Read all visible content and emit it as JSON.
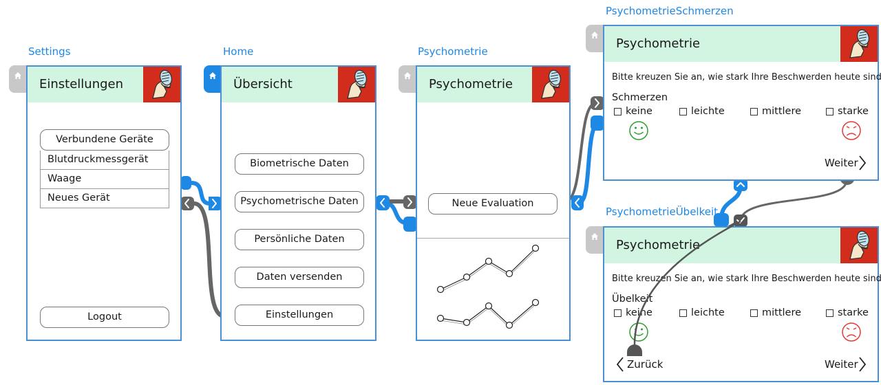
{
  "colors": {
    "accent": "#1e88e5",
    "header_bg": "#d2f5e2",
    "logo_red": "#d22c1c",
    "connector_gray": "#666666",
    "smiley_green": "#2ca02c",
    "frown_red": "#e53935"
  },
  "settings": {
    "label": "Settings",
    "title": "Einstellungen",
    "connected_devices_button": "Verbundene Geräte",
    "devices": [
      "Blutdruckmessgerät",
      "Waage",
      "Neues Gerät"
    ],
    "logout_button": "Logout"
  },
  "home": {
    "label": "Home",
    "title": "Übersicht",
    "buttons": [
      "Biometrische Daten",
      "Psychometrische Daten",
      "Persönliche Daten",
      "Daten versenden",
      "Einstellungen"
    ]
  },
  "psychometrie": {
    "label": "Psychometrie",
    "title": "Psychometrie",
    "new_eval_button": "Neue Evaluation"
  },
  "schmerzen": {
    "label": "PsychometrieSchmerzen",
    "title": "Psychometrie",
    "instruction": "Bitte kreuzen Sie an, wie stark Ihre Beschwerden heute sind.",
    "question": "Schmerzen",
    "options": [
      "keine",
      "leichte",
      "mittlere",
      "starke"
    ],
    "next": "Weiter"
  },
  "uebelkeit": {
    "label": "PsychometrieÜbelkeit",
    "title": "Psychometrie",
    "instruction": "Bitte kreuzen Sie an, wie stark Ihre Beschwerden heute sind.",
    "question": "Übelkeit",
    "options": [
      "keine",
      "leichte",
      "mittlere",
      "starke"
    ],
    "back": "Zurück",
    "next": "Weiter"
  }
}
